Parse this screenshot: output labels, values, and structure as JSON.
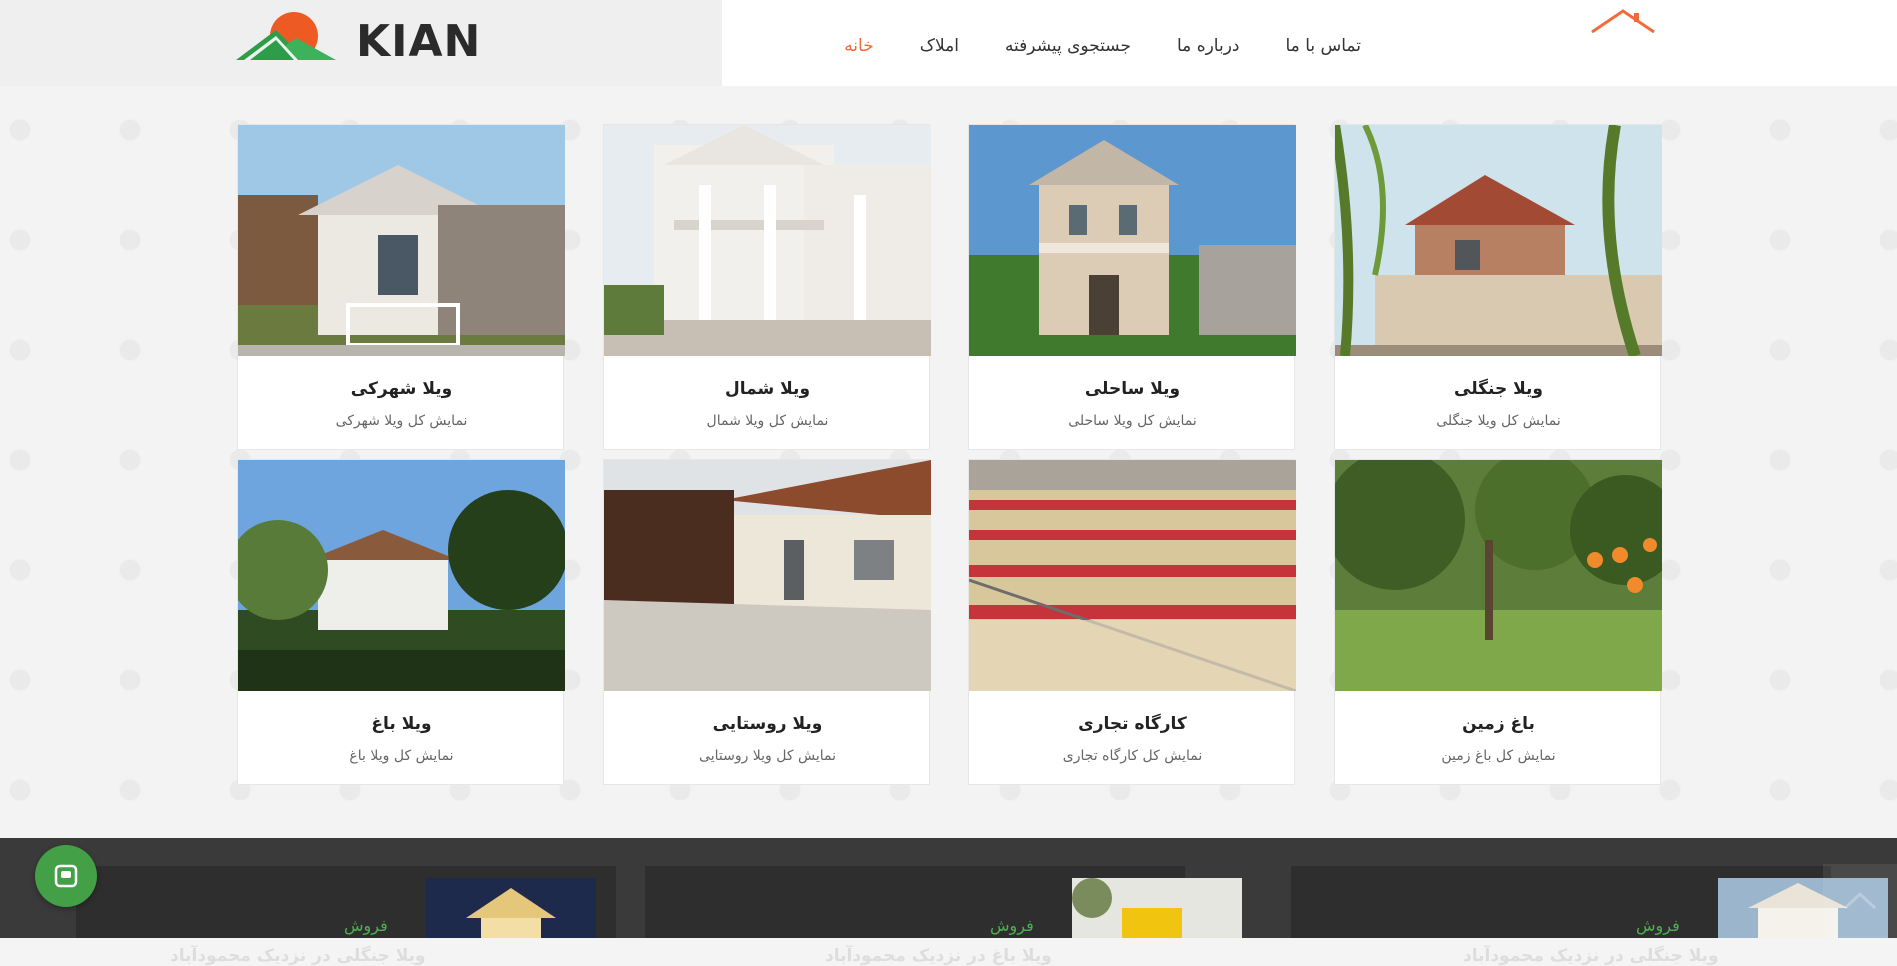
{
  "brand": {
    "logo_text": "KIAN"
  },
  "nav": {
    "items": [
      {
        "label": "خانه",
        "active": true
      },
      {
        "label": "املاک",
        "active": false
      },
      {
        "label": "جستجوی پیشرفته",
        "active": false
      },
      {
        "label": "درباره ما",
        "active": false
      },
      {
        "label": "تماس با ما",
        "active": false
      }
    ]
  },
  "categories": [
    {
      "title": "ویلا شهرکی",
      "link": "نمایش کل ویلا شهرکی",
      "image": "villa-town-photo"
    },
    {
      "title": "ویلا شمال",
      "link": "نمایش کل ویلا شمال",
      "image": "villa-north-photo"
    },
    {
      "title": "ویلا ساحلی",
      "link": "نمایش کل ویلا ساحلی",
      "image": "villa-beach-photo"
    },
    {
      "title": "ویلا جنگلی",
      "link": "نمایش کل ویلا جنگلی",
      "image": "villa-forest-photo"
    },
    {
      "title": "ویلا باغ",
      "link": "نمایش کل ویلا باغ",
      "image": "villa-garden-photo"
    },
    {
      "title": "ویلا روستایی",
      "link": "نمایش کل ویلا روستایی",
      "image": "villa-rural-photo"
    },
    {
      "title": "کارگاه تجاری",
      "link": "نمایش کل کارگاه تجاری",
      "image": "commercial-workshop-photo"
    },
    {
      "title": "باغ زمین",
      "link": "نمایش کل باغ زمین",
      "image": "orchard-land-photo"
    }
  ],
  "featured": [
    {
      "tag": "فروش",
      "title": "ویلا جنگلی در نزدیک محمودآباد"
    },
    {
      "tag": "فروش",
      "title": "ویلا باغ در نزدیک محمودآباد"
    },
    {
      "tag": "فروش",
      "title": "ویلا جنگلی در نزدیک محمودآباد"
    }
  ],
  "colors": {
    "accent": "#f26b3a",
    "green": "#43a047",
    "footer": "#3a3a3a"
  }
}
